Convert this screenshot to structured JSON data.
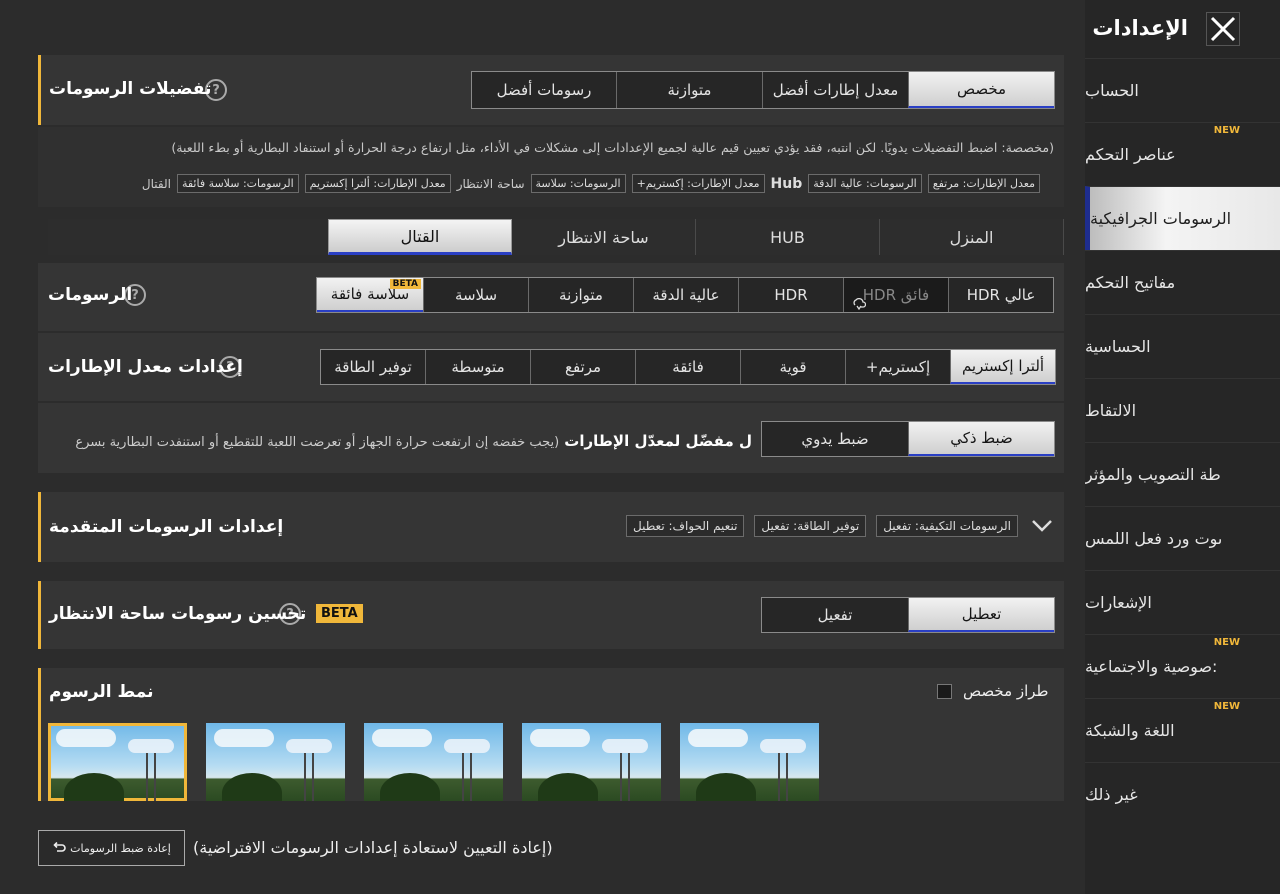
{
  "header": {
    "title": "الإعدادات",
    "close_icon": "close-icon"
  },
  "sidebar": {
    "new_label": "NEW",
    "items": [
      {
        "label": "الحساب",
        "new": false,
        "active": false
      },
      {
        "label": "عناصر التحكم",
        "new": true,
        "active": false
      },
      {
        "label": "الرسومات الجرافيكية",
        "new": false,
        "active": true
      },
      {
        "label": "مفاتيح التحكم",
        "new": false,
        "active": false
      },
      {
        "label": "الحساسية",
        "new": false,
        "active": false
      },
      {
        "label": "الالتقاط",
        "new": false,
        "active": false
      },
      {
        "label": "طة التصويب والمؤثر",
        "new": false,
        "active": false
      },
      {
        "label": "ىوت ورد فعل اللمس",
        "new": false,
        "active": false
      },
      {
        "label": "الإشعارات",
        "new": false,
        "active": false
      },
      {
        "label": ":صوصية والاجتماعية",
        "new": true,
        "active": false
      },
      {
        "label": "اللغة والشبكة",
        "new": true,
        "active": false
      },
      {
        "label": "غير ذلك",
        "new": false,
        "active": false
      }
    ]
  },
  "graphics_pref": {
    "title": "تفضيلات الرسومات",
    "options": [
      "مخصص",
      "معدل إطارات أفضل",
      "متوازنة",
      "رسومات أفضل"
    ],
    "selected": "مخصص",
    "description": "(مخصصة: اضبط التفضيلات يدويًا. لكن انتبه، فقد يؤدي تعيين قيم عالية لجميع الإعدادات إلى مشكلات في الأداء، مثل ارتفاع درجة الحرارة أو استنفاد البطارية أو بطء اللعبة)",
    "summary": {
      "home_fps": "معدل الإطارات: مرتفع",
      "home_graphics": "الرسومات: عالية الدقة",
      "hub_label": "Hub",
      "hub_fps": "معدل الإطارات: إكستريم+",
      "hub_graphics": "الرسومات: سلاسة",
      "lobby_label": "ساحة الانتظار",
      "lobby_fps": "معدل الإطارات: ألترا إكستريم",
      "lobby_graphics": "الرسومات: سلاسة فائقة",
      "combat_label": "القتال"
    }
  },
  "mode_tabs": {
    "items": [
      "المنزل",
      "HUB",
      "ساحة الانتظار",
      "القتال"
    ],
    "selected": "القتال"
  },
  "graphics": {
    "title": "الرسومات",
    "options": [
      "عالي HDR",
      "فائق HDR",
      "HDR",
      "عالية الدقة",
      "متوازنة",
      "سلاسة",
      "سلاسة فائقة"
    ],
    "selected": "سلاسة فائقة",
    "beta_label": "BETA",
    "locked": "فائق HDR"
  },
  "fps": {
    "title": "إعدادات معدل الإطارات",
    "options": [
      "ألترا إكستريم",
      "إكستريم+",
      "قوية",
      "فائقة",
      "مرتفع",
      "متوسطة",
      "توفير الطاقة"
    ],
    "selected": "ألترا إكستريم"
  },
  "fps_adjust": {
    "options": [
      "ضبط ذكي",
      "ضبط يدوي"
    ],
    "selected": "ضبط ذكي",
    "label": "ل مفضّل لمعدّل الإطارات",
    "note": "(يجب خفضه إن ارتفعت حرارة الجهاز أو تعرضت اللعبة للتقطيع أو استنفدت البطارية بسرع"
  },
  "advanced": {
    "title": "إعدادات الرسومات المتقدمة",
    "chips": [
      "الرسومات التكيفية: تفعيل",
      "توفير الطاقة: تفعيل",
      "تنعيم الحواف: تعطيل"
    ]
  },
  "lobby_enhance": {
    "title": "تحسين رسومات ساحة الانتظار",
    "beta_label": "BETA",
    "options": [
      "تعطيل",
      "تفعيل"
    ],
    "selected": "تعطيل"
  },
  "style": {
    "title": "نمط الرسوم",
    "custom_label": "طراز مخصص",
    "thumbnails": 5,
    "selected_index": 0
  },
  "reset": {
    "button_label": "إعادة ضبط الرسومات",
    "note": "(إعادة التعيين لاستعادة إعدادات الرسومات الافتراضية)"
  },
  "colors": {
    "accent": "#f0b73a",
    "select_underline": "#2a3fc4",
    "background": "#2c2c2c"
  }
}
